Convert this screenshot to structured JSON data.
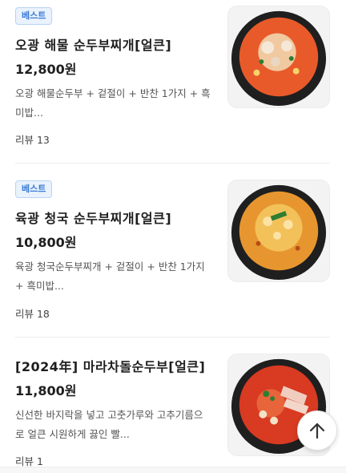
{
  "menu": {
    "items": [
      {
        "badge": "베스트",
        "name": "오광 해물 순두부찌개[얼큰]",
        "price": "12,800원",
        "description": "오광 해물순두부 + 겉절이 + 반찬 1가지 + 흑미밥...",
        "review": "리뷰 13"
      },
      {
        "badge": "베스트",
        "name": "육광 청국 순두부찌개[얼큰]",
        "price": "10,800원",
        "description": "육광 청국순두부찌개 + 겉절이 + 반찬 1가지 + 흑미밥...",
        "review": "리뷰 18"
      },
      {
        "name": "[2024年] 마라차돌순두부[얼큰]",
        "price": "11,800원",
        "description": "신선한 바지락을 넣고 고춧가루와 고추기름으로 얼큰 시원하게 끓인 빨...",
        "review": "리뷰 1"
      }
    ]
  },
  "scroll_top_icon": "arrow-up-icon",
  "colors": {
    "badge_bg": "#e9f2fd",
    "badge_text": "#3a7bd5",
    "divider": "#ececec"
  }
}
